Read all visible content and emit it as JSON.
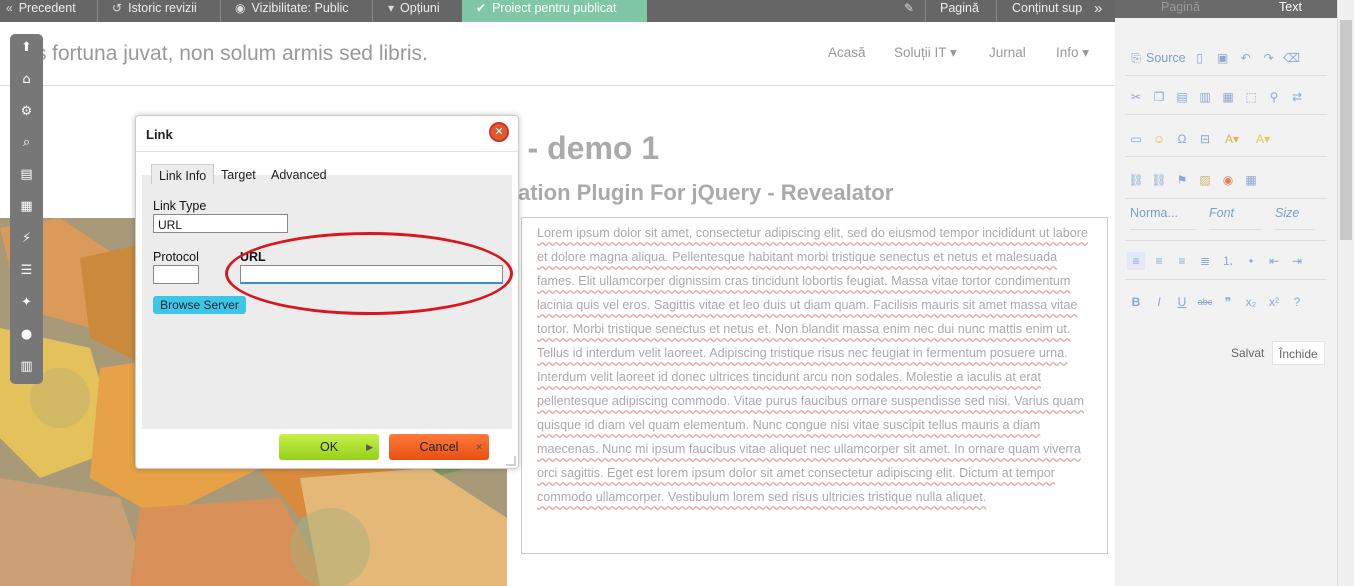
{
  "topbar": {
    "prev": "Precedent",
    "history": "Istoric revizii",
    "visibility": "Vizibilitate: Public",
    "options": "Opțiuni",
    "publish": "Proiect pentru publicat",
    "page": "Pagină",
    "content": "Conținut sup"
  },
  "header": {
    "tagline": "fortuna juvat, non solum armis sed libris.",
    "tagline_prefix": "s",
    "nav": [
      "Acasă",
      "Soluții IT ▾",
      "Jurnal",
      "Info ▾"
    ]
  },
  "page": {
    "title": "t - demo 1",
    "subtitle": "ation Plugin For jQuery - Revealator",
    "lorem": "Lorem ipsum dolor sit amet, consectetur adipiscing elit, sed do eiusmod tempor incididunt ut labore et dolore magna aliqua. Pellentesque habitant morbi tristique senectus et netus et malesuada fames. Elit ullamcorper dignissim cras tincidunt lobortis feugiat. Massa vitae tortor condimentum lacinia quis vel eros. Sagittis vitae et leo duis ut diam quam. Facilisis mauris sit amet massa vitae tortor. Morbi tristique senectus et netus et. Non blandit massa enim nec dui nunc mattis enim ut. Tellus id interdum velit laoreet. Adipiscing tristique risus nec feugiat in fermentum posuere urna. Interdum velit laoreet id donec ultrices tincidunt arcu non sodales. Molestie a iaculis at erat pellentesque adipiscing commodo. Vitae purus faucibus ornare suspendisse sed nisi. Varius quam quisque id diam vel quam elementum. Nunc congue nisi vitae suscipit tellus mauris a diam maecenas. Nunc mi ipsum faucibus vitae aliquet nec ullamcorper sit amet. In ornare quam viverra orci sagittis. Eget est lorem ipsum dolor sit amet consectetur adipiscing elit. Dictum at tempor commodo ullamcorper. Vestibulum lorem sed risus ultricies tristique nulla aliquet."
  },
  "dialog": {
    "title": "Link",
    "tabs": [
      "Link Info",
      "Target",
      "Advanced"
    ],
    "link_type_label": "Link Type",
    "link_type_value": "URL",
    "protocol_label": "Protocol",
    "protocol_value": "",
    "url_label": "URL",
    "url_value": "",
    "browse": "Browse Server",
    "ok": "OK",
    "cancel": "Cancel"
  },
  "right_panel": {
    "tab_page": "Pagină",
    "tab_text": "Text",
    "source": "Source",
    "format": "Norma...",
    "font": "Font",
    "size": "Size",
    "save": "Salvat",
    "close": "Închide"
  },
  "colors": {
    "topbar": "#666666",
    "publish": "#7fc7a5",
    "highlight": "#d9161c",
    "ok": "#95d01a",
    "cancel": "#e84f12",
    "browse": "#3cc7e8"
  }
}
